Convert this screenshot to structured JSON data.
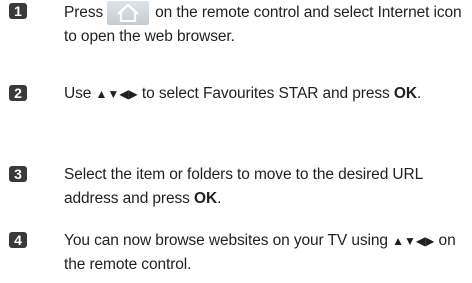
{
  "steps": [
    {
      "number": "1",
      "text_before_icon": "Press",
      "text_after_icon": "on the remote control and select Internet icon to open the web browser."
    },
    {
      "number": "2",
      "text_before_arrows": "Use",
      "arrows": "▲▼◀▶",
      "text_after_arrows": "to select Favourites STAR and press",
      "bold": "OK",
      "text_end": "."
    },
    {
      "number": "3",
      "text": "Select the item or folders to move to the desired URL address and press",
      "bold": "OK",
      "text_end": "."
    },
    {
      "number": "4",
      "text_line1": "You can now browse websites on your TV using",
      "arrows": "▲▼◀▶",
      "text_after_arrows": "on the remote control."
    }
  ],
  "icons": {
    "home_button": "home-icon"
  }
}
